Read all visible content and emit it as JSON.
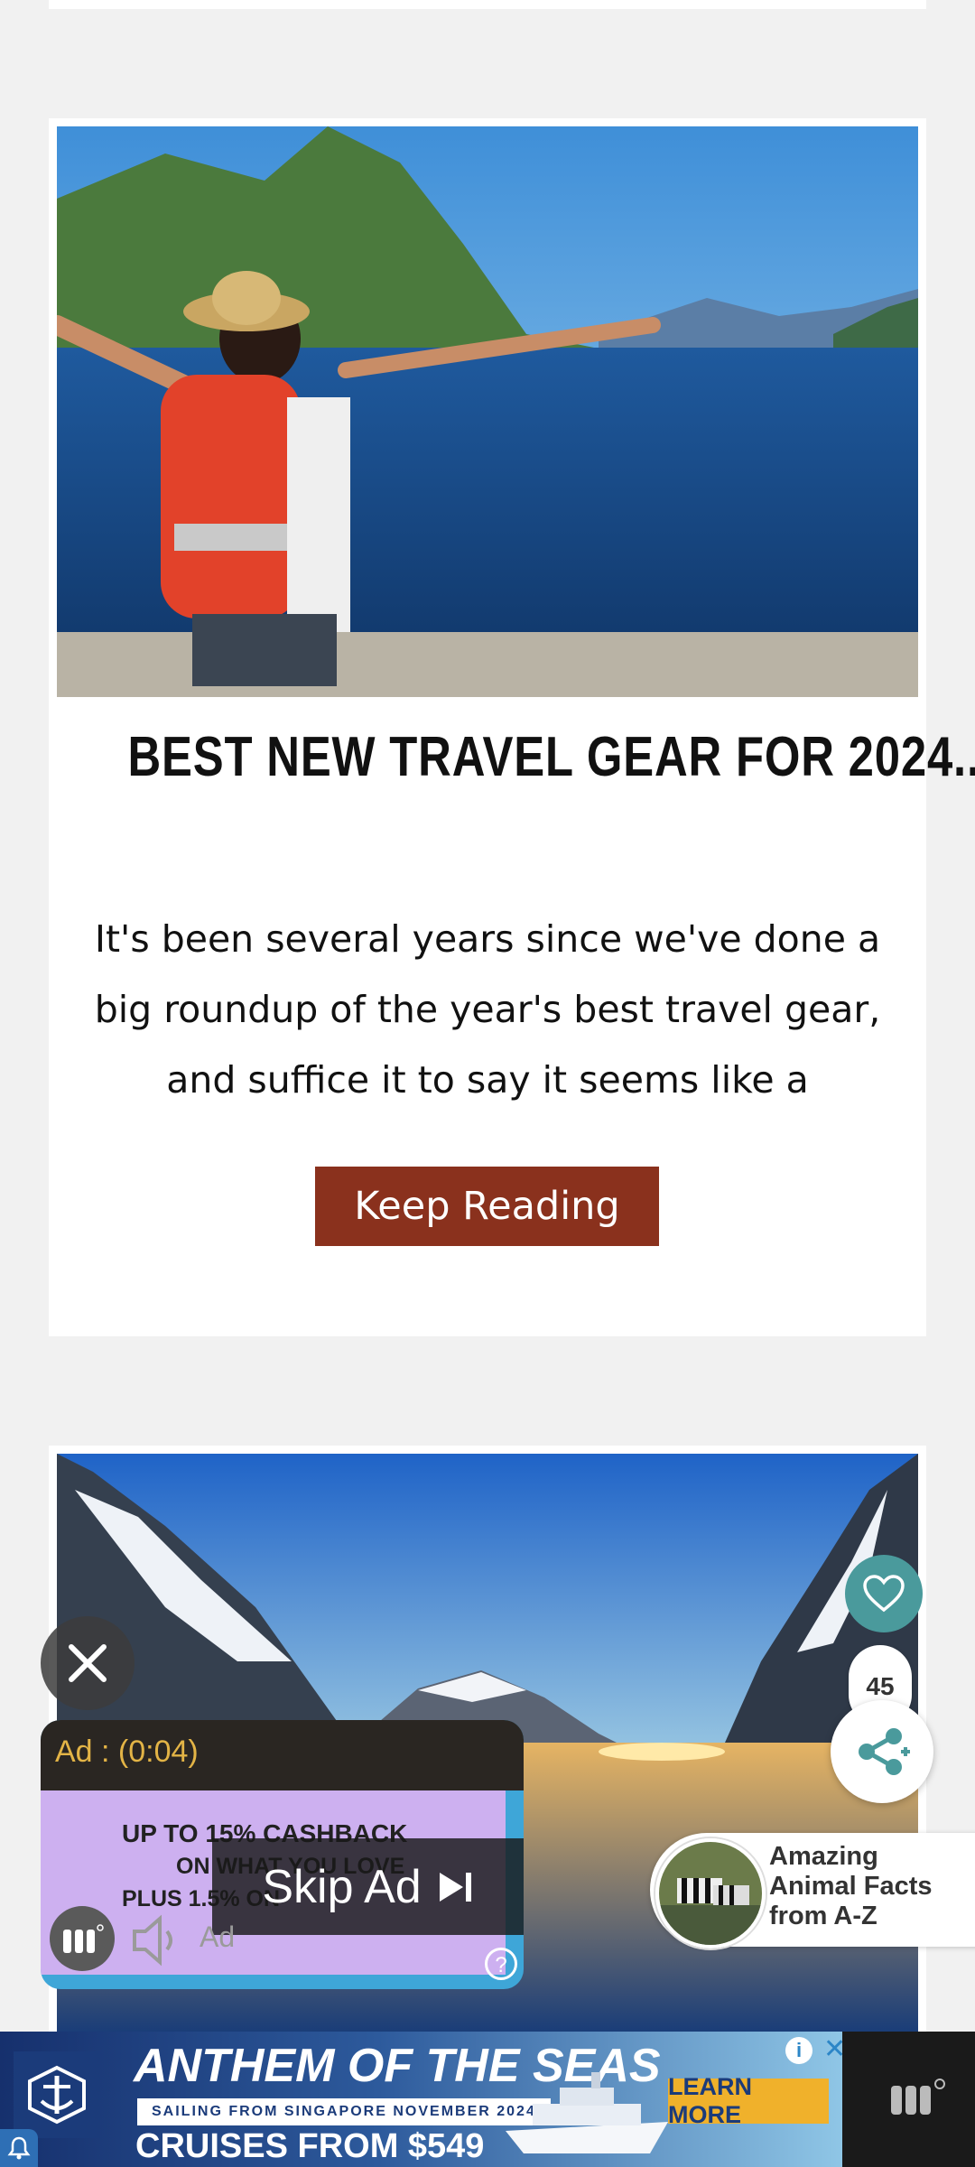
{
  "article": {
    "title": "BEST NEW TRAVEL GEAR FOR 2024...",
    "excerpt": "It's been several years since we've done a big roundup of the year's best travel gear, and suffice it to say it seems like a",
    "cta": "Keep Reading"
  },
  "social": {
    "share_count": "45"
  },
  "promo": {
    "text": "Amazing Animal Facts from A-Z"
  },
  "video_ad": {
    "timer": "Ad : (0:04)",
    "creative_line1": "UP TO 15% CASHBACK",
    "creative_line2": "ON WHAT YOU LOVE",
    "creative_line3": "PLUS 1.5% ON",
    "skip": "Skip Ad",
    "label": "Ad",
    "help": "?"
  },
  "banner_ad": {
    "title": "ANTHEM OF THE SEAS",
    "subtitle": "SAILING FROM SINGAPORE NOVEMBER 2024",
    "price": "CRUISES FROM $549",
    "cta": "LEARN MORE",
    "info": "i",
    "close": "✕"
  },
  "colors": {
    "button_bg": "#8a311d",
    "accent_teal": "#4a9a9c",
    "ad_timer": "#e3b446"
  }
}
